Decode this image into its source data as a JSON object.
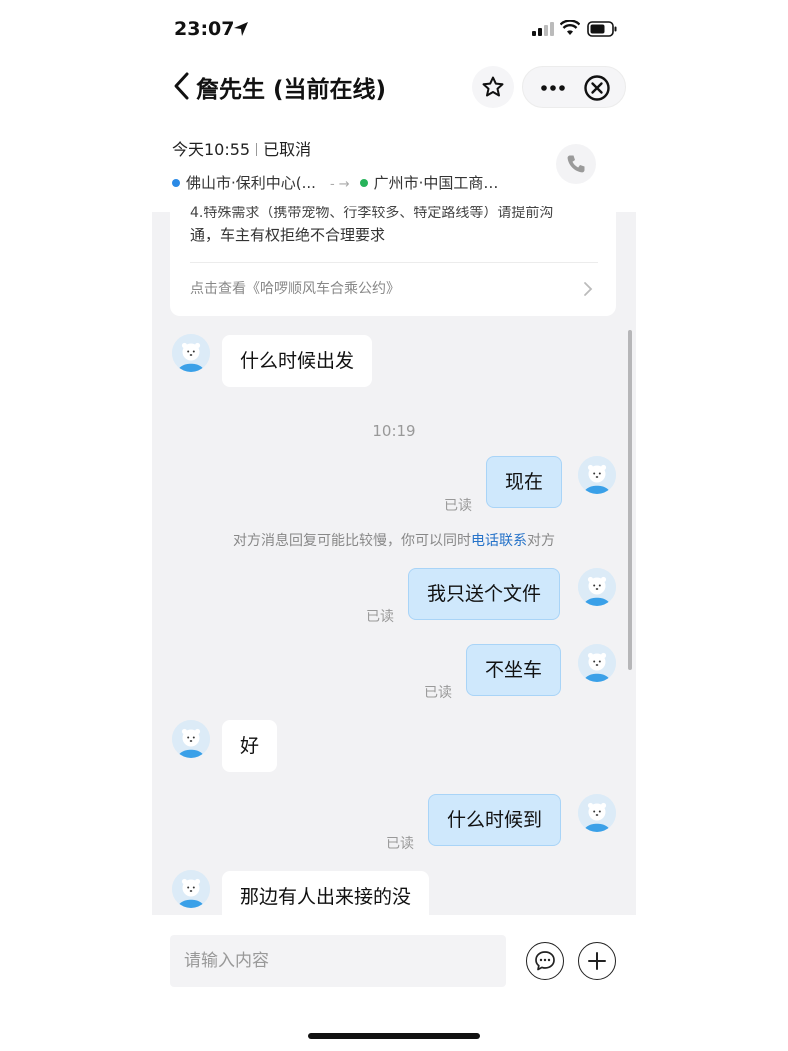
{
  "status_bar": {
    "time": "23:07"
  },
  "nav": {
    "title": "詹先生 (当前在线)"
  },
  "order": {
    "day_time": "今天10:55",
    "status": "已取消",
    "from": "佛山市·保利中心(...",
    "to": "广州市·中国工商…"
  },
  "notice": {
    "cut_line": "4.特殊需求（携带宠物、行李较多、特定路线等）请提前沟",
    "line2": "通，车主有权拒绝不合理要求",
    "link": "点击查看《哈啰顺风车合乘公约》"
  },
  "messages": {
    "m1": "什么时候出发",
    "ts1": "10:19",
    "m2": "现在",
    "m2_read": "已读",
    "sys_before": "对方消息回复可能比较慢，你可以同时",
    "sys_link": "电话联系",
    "sys_after": "对方",
    "m3": "我只送个文件",
    "m3_read": "已读",
    "m4": "不坐车",
    "m4_read": "已读",
    "m5": "好",
    "m6": "什么时候到",
    "m6_read": "已读",
    "m7": "那边有人出来接的没"
  },
  "input": {
    "placeholder": "请输入内容"
  },
  "icons": {
    "back": "chevron-left-icon",
    "star": "star-icon",
    "more": "more-icon",
    "close": "close-circle-icon",
    "phone": "phone-icon",
    "emoji": "chat-bubble-icon",
    "plus": "plus-circle-icon"
  },
  "colors": {
    "bubble_out": "#cfe8fc",
    "link": "#2673c9",
    "chat_bg": "#f2f2f4"
  }
}
